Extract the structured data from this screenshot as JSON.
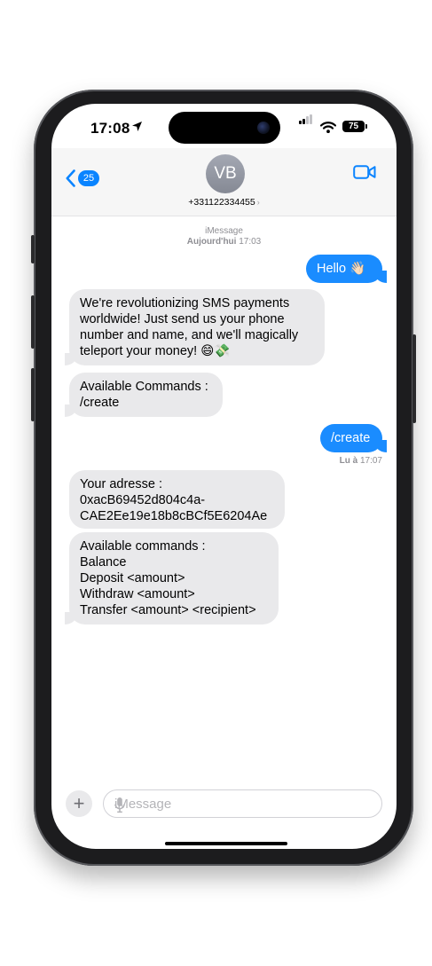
{
  "status_bar": {
    "time": "17:08",
    "battery": "75",
    "icons": [
      "location-arrow-icon",
      "signal-icon",
      "wifi-icon",
      "battery-icon"
    ]
  },
  "nav": {
    "back_badge": "25",
    "avatar_initials": "VB",
    "contact": "+331122334455",
    "contact_chevron": "›",
    "icons": [
      "chevron-left-icon",
      "video-camera-icon"
    ]
  },
  "conversation": {
    "service": "iMessage",
    "timestamp_day": "Aujourd'hui",
    "timestamp_time": "17:03",
    "messages": [
      {
        "direction": "outgoing",
        "text": "Hello 👋🏻"
      },
      {
        "direction": "incoming",
        "text": "We're revolutionizing SMS payments\nworldwide! Just send us your phone\nnumber and name, and we'll magically\nteleport your money! 😄💸"
      },
      {
        "direction": "incoming",
        "text": "Available Commands :\n/create"
      },
      {
        "direction": "outgoing",
        "text": "/create"
      },
      {
        "direction": "incoming",
        "text": "Your adresse :\n0xacB69452d804c4a-\nCAE2Ee19e18b8cBCf5E6204Ae"
      },
      {
        "direction": "incoming",
        "text": "Available commands :\nBalance\nDeposit <amount>\nWithdraw <amount>\nTransfer <amount> <recipient>"
      }
    ],
    "delivered_day": "Lu à",
    "delivered_time": "17:07"
  },
  "composer": {
    "plus": "+",
    "placeholder": "iMessage",
    "icons": [
      "plus-icon",
      "microphone-icon"
    ]
  },
  "colors": {
    "outgoing_bubble": "#1a8cff",
    "incoming_bubble": "#e9e9eb",
    "accent": "#0a84ff",
    "phone_frame": "#1c1c1e"
  }
}
